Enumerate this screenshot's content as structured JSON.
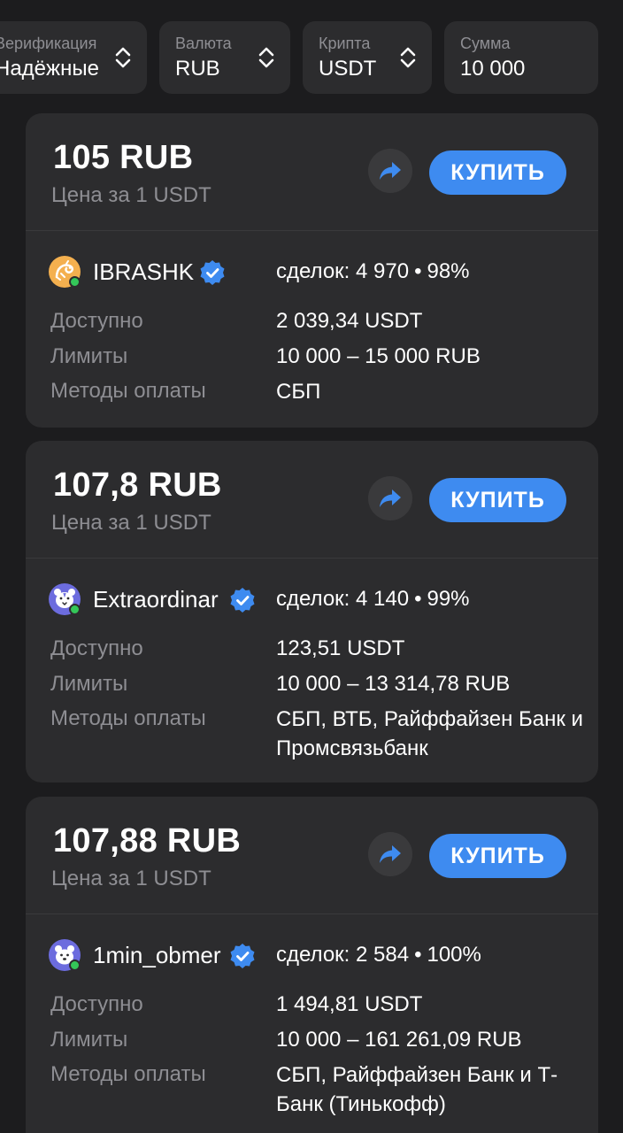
{
  "filters": {
    "verification": {
      "label": "Верификация",
      "value": "Надёжные"
    },
    "currency": {
      "label": "Валюта",
      "value": "RUB"
    },
    "crypto": {
      "label": "Крипта",
      "value": "USDT"
    },
    "amount": {
      "label": "Сумма",
      "value": "10 000"
    }
  },
  "colors": {
    "background": "#1c1c1e",
    "card": "#2c2c2e",
    "accent": "#3e8bf0",
    "muted_text": "#8e8e93",
    "online": "#34c759",
    "verified": "#3e8bf0"
  },
  "labels": {
    "price_caption": "Цена за 1 USDT",
    "buy": "КУПИТЬ",
    "available": "Доступно",
    "limits": "Лимиты",
    "payment_methods": "Методы оплаты",
    "deals_prefix": "сделок:",
    "separator": "•"
  },
  "offers": [
    {
      "price": "105 RUB",
      "trader": "IBRASHK",
      "avatar_icon": "lizard-avatar-icon",
      "deals": "4 970",
      "completion": "98%",
      "available": "2 039,34 USDT",
      "limits": "10 000 – 15 000 RUB",
      "payment_methods": "СБП"
    },
    {
      "price": "107,8 RUB",
      "trader": "Extraordinar",
      "avatar_icon": "tiger-avatar-icon",
      "deals": "4 140",
      "completion": "99%",
      "available": "123,51 USDT",
      "limits": "10 000 – 13 314,78 RUB",
      "payment_methods": "СБП, ВТБ, Райффайзен Банк и Промсвязьбанк"
    },
    {
      "price": "107,88 RUB",
      "trader": "1min_obmer",
      "avatar_icon": "bear-avatar-icon",
      "deals": "2 584",
      "completion": "100%",
      "available": "1 494,81 USDT",
      "limits": "10 000 – 161 261,09 RUB",
      "payment_methods": "СБП, Райффайзен Банк и Т-Банк (Тинькофф)"
    }
  ]
}
